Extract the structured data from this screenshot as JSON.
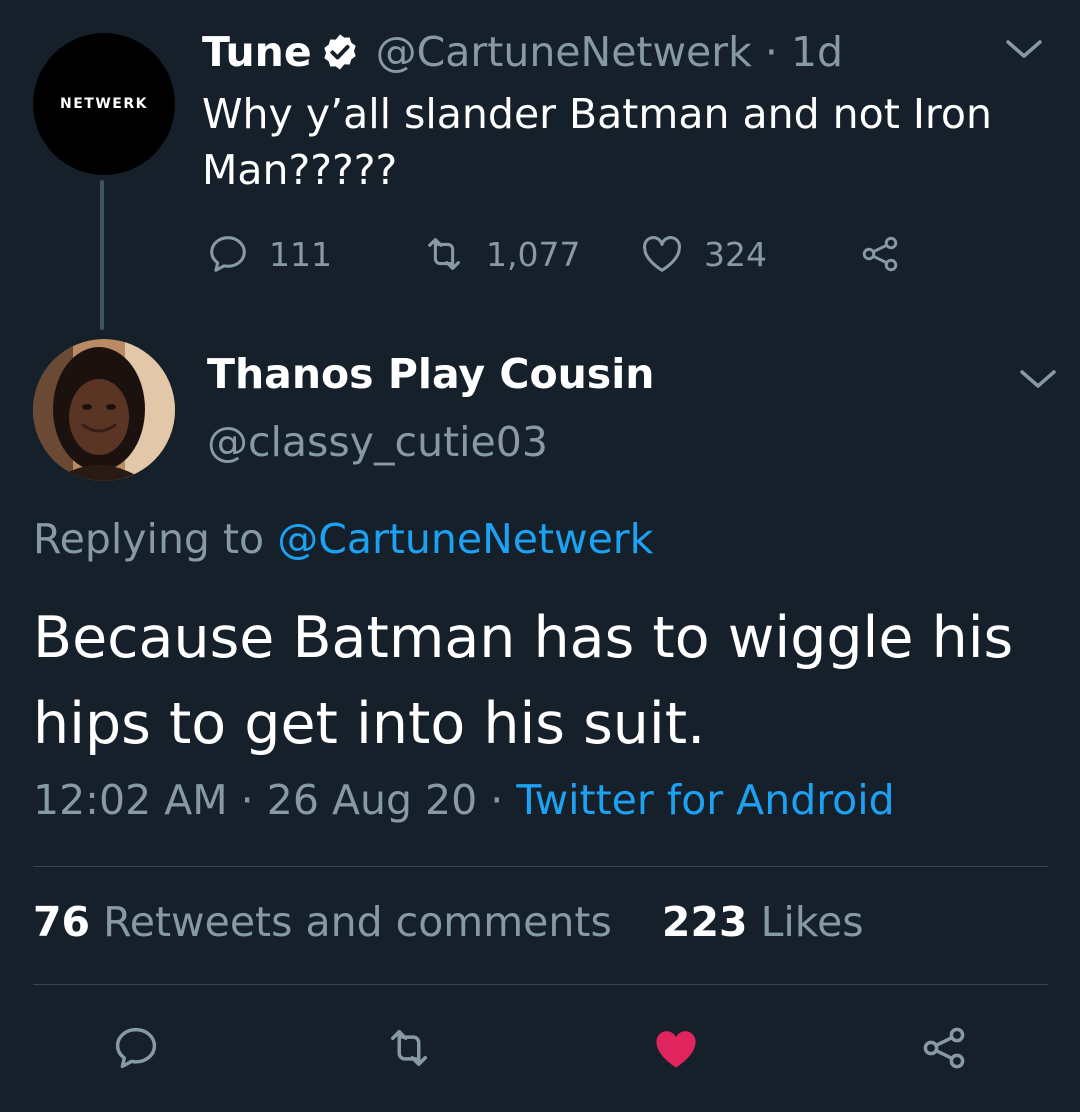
{
  "parent_tweet": {
    "avatar_text": "NETWERK",
    "display_name": "Tune",
    "handle_and_time": "@CartuneNetwerk · 1d",
    "text": "Why y’all slander Batman and not Iron Man?????",
    "reply_count": "111",
    "retweet_count": "1,077",
    "like_count": "324"
  },
  "reply_tweet": {
    "display_name": "Thanos Play Cousin",
    "handle": "@classy_cutie03",
    "replying_to_label": "Replying to",
    "replying_to_handle": "@CartuneNetwerk",
    "text": "Because Batman has to wiggle his hips to get into his suit.",
    "time": "12:02 AM",
    "date": "26 Aug 20",
    "source": "Twitter for Android",
    "retweets_and_comments_count": "76",
    "retweets_and_comments_label": "Retweets and comments",
    "likes_count": "223",
    "likes_label": "Likes",
    "liked": true
  },
  "colors": {
    "background": "#15202b",
    "text": "#ffffff",
    "muted": "#8899a6",
    "link": "#1da1f2",
    "like": "#e0245e",
    "divider": "#38444d"
  },
  "icons": {
    "reply": "speech-bubble-icon",
    "retweet": "retweet-arrows-icon",
    "like": "heart-icon",
    "share": "share-nodes-icon",
    "verified": "verified-badge-icon",
    "more": "chevron-down-icon"
  },
  "separator": " · "
}
